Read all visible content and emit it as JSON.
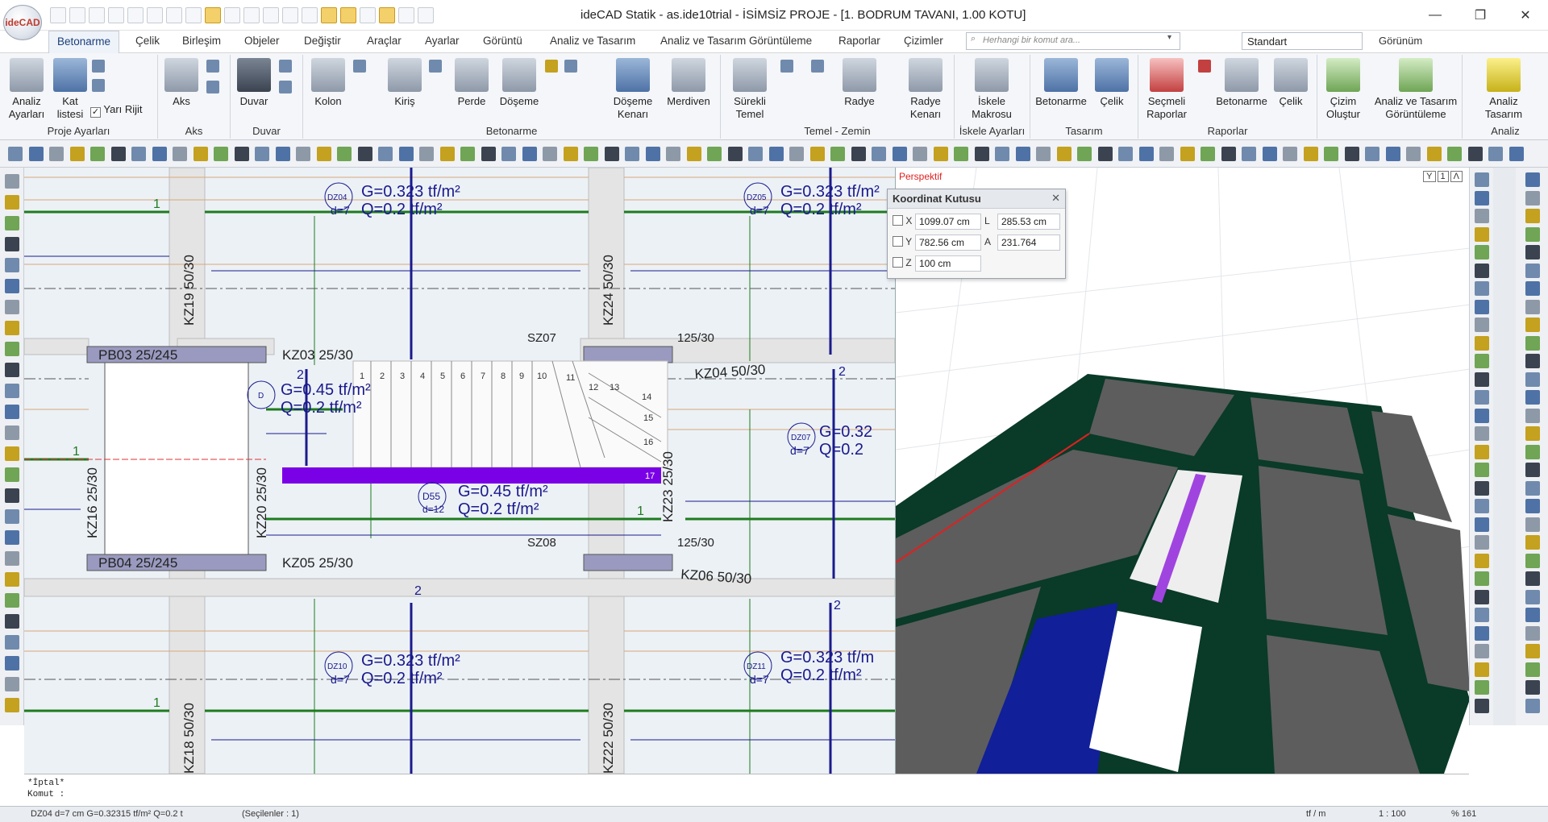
{
  "app": {
    "title": "ideCAD Statik - as.ide10trial - İSİMSİZ PROJE - [1. BODRUM TAVANI,  1.00 KOTU]",
    "logo_text": "ideCAD"
  },
  "menu": {
    "tabs": [
      "Betonarme",
      "Çelik",
      "Birleşim",
      "Objeler",
      "Değiştir",
      "Araçlar",
      "Ayarlar",
      "Görüntü",
      "Analiz ve Tasarım",
      "Analiz ve Tasarım Görüntüleme",
      "Raporlar",
      "Çizimler"
    ],
    "active_tab": "Betonarme",
    "search_placeholder": "Herhangi bir komut ara...",
    "style_combo": "Standart",
    "view_menu": "Görünüm"
  },
  "ribbon": {
    "groups": [
      {
        "label": "Proje Ayarları",
        "buttons": [
          "Analiz Ayarları",
          "Kat listesi"
        ],
        "checkbox": "Yarı Rijit"
      },
      {
        "label": "Aks",
        "buttons": [
          "Aks"
        ]
      },
      {
        "label": "Duvar",
        "buttons": [
          "Duvar"
        ]
      },
      {
        "label": "Betonarme",
        "buttons": [
          "Kolon",
          "Kiriş",
          "Perde",
          "Döşeme",
          "Döşeme Kenarı",
          "Merdiven"
        ]
      },
      {
        "label": "Temel - Zemin",
        "buttons": [
          "Sürekli Temel",
          "Radye",
          "Radye Kenarı"
        ]
      },
      {
        "label": "İskele Ayarları",
        "buttons": [
          "İskele Makrosu"
        ]
      },
      {
        "label": "Tasarım",
        "buttons": [
          "Betonarme",
          "Çelik"
        ]
      },
      {
        "label": "Raporlar",
        "buttons": [
          "Seçmeli Raporlar",
          "Betonarme",
          "Çelik"
        ]
      },
      {
        "label": "",
        "buttons": [
          "Çizim Oluştur",
          "Analiz ve Tasarım Görüntüleme"
        ]
      },
      {
        "label": "Analiz",
        "buttons": [
          "Analiz Tasarım"
        ]
      }
    ]
  },
  "plan": {
    "slab_labels": [
      {
        "id": "DZ04",
        "g": "G=0.323 tf/m²",
        "q": "Q=0.2 tf/m²",
        "d": "d=7"
      },
      {
        "id": "DZ05",
        "g": "G=0.323 tf/m²",
        "q": "Q=0.2 tf/m²",
        "d": "d=7"
      },
      {
        "id": "D",
        "g": "G=0.45 tf/m²",
        "q": "Q=0.2 tf/m²",
        "d": ""
      },
      {
        "id": "DZ07",
        "g": "G=0.32",
        "q": "Q=0.2",
        "d": "d=7"
      },
      {
        "id": "D55",
        "g": "G=0.45 tf/m²",
        "q": "Q=0.2 tf/m²",
        "d": "d=12"
      },
      {
        "id": "DZ10",
        "g": "G=0.323 tf/m²",
        "q": "Q=0.2 tf/m²",
        "d": "d=7"
      },
      {
        "id": "DZ11",
        "g": "G=0.323 tf/m",
        "q": "Q=0.2 tf/m²",
        "d": "d=7"
      }
    ],
    "beam_labels": [
      "PB03 25/245",
      "KZ03 25/30",
      "KZ04 50/30",
      "PB04 25/245",
      "KZ05 25/30",
      "KZ06 50/30",
      "SZ07",
      "SZ08",
      "KZ19 50/30",
      "KZ24 50/30",
      "KZ16 25/30",
      "KZ20 25/30",
      "KZ23 25/30",
      "KZ18 50/30",
      "KZ22 50/30",
      "125/30",
      "125/30"
    ],
    "stair_numbers": [
      "1",
      "2",
      "3",
      "4",
      "5",
      "6",
      "7",
      "8",
      "9",
      "10",
      "11",
      "12",
      "13",
      "14",
      "15",
      "16",
      "17"
    ],
    "grid_numbers": [
      "1",
      "1",
      "1",
      "2",
      "2",
      "2",
      "2",
      "1"
    ]
  },
  "perspective": {
    "label": "Perspektif",
    "view_ctl": [
      "Y",
      "1",
      "Λ"
    ]
  },
  "coord_box": {
    "title": "Koordinat Kutusu",
    "x_label": "X",
    "x_value": "1099.07 cm",
    "y_label": "Y",
    "y_value": "782.56 cm",
    "z_label": "Z",
    "z_value": "100 cm",
    "l_label": "L",
    "l_value": "285.53 cm",
    "a_label": "A",
    "a_value": "231.764"
  },
  "command": {
    "line1": "*İptal*",
    "line2": "Komut :"
  },
  "status": {
    "selection": "DZ04 d=7 cm G=0.32315 tf/m² Q=0.2 t",
    "selected_count": "(Seçilenler : 1)",
    "units": "tf / m",
    "scale": "1 : 100",
    "zoom": "% 161"
  },
  "colors": {
    "beam_green": "#1e7b1e",
    "axis_blue": "#1a1a8c",
    "stair_purple": "#7a00e6",
    "slab_dark": "#5d5d5d",
    "beam_dark": "#0a3a28",
    "accent_red": "#e02020"
  }
}
